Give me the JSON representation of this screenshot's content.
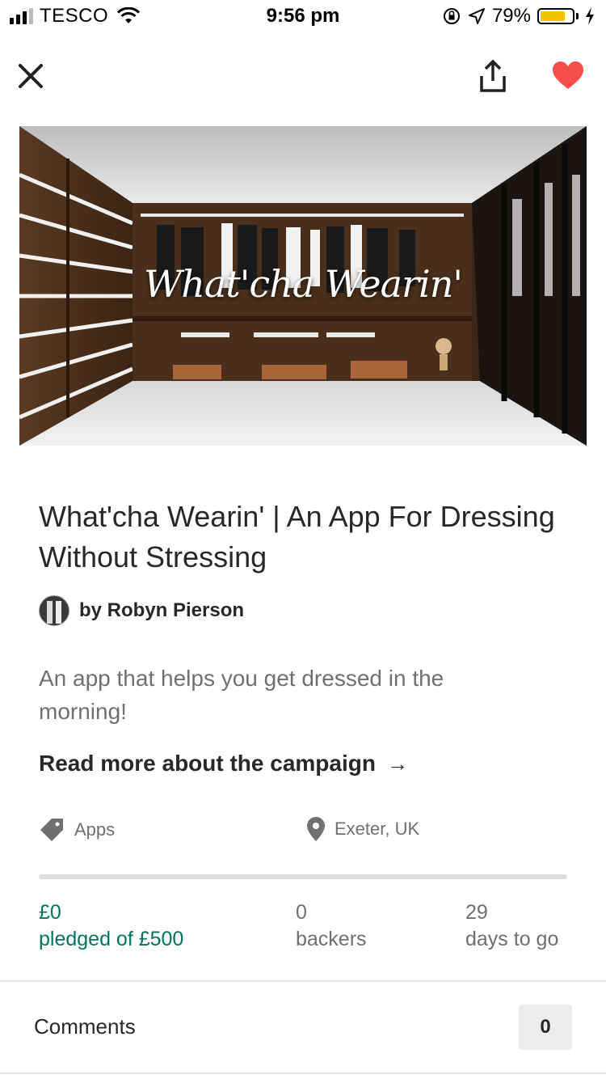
{
  "status_bar": {
    "carrier": "TESCO",
    "time": "9:56 pm",
    "battery": "79%",
    "battery_level": 0.79
  },
  "nav": {
    "close_icon": "close-icon",
    "share_icon": "share-icon",
    "favorite_icon": "heart-icon",
    "favorite_color": "#f74d4d"
  },
  "hero": {
    "title_overlay": "What'cha Wearin'"
  },
  "project": {
    "title": "What'cha Wearin' | An App For Dressing Without Stressing",
    "creator": "by Robyn Pierson",
    "blurb": "An app that helps you get dressed in the morning!",
    "read_more": "Read more about the campaign",
    "category": "Apps",
    "location": "Exeter, UK",
    "progress_fraction": 0
  },
  "stats": {
    "pledged": "£0",
    "pledged_label": "pledged of £500",
    "backers": "0",
    "backers_label": "backers",
    "days": "29",
    "days_label": "days to go"
  },
  "comments": {
    "label": "Comments",
    "count": "0"
  },
  "colors": {
    "accent_green": "#037362",
    "heart_red": "#f74d4d",
    "text_dark": "#282828",
    "text_muted": "#707070"
  }
}
